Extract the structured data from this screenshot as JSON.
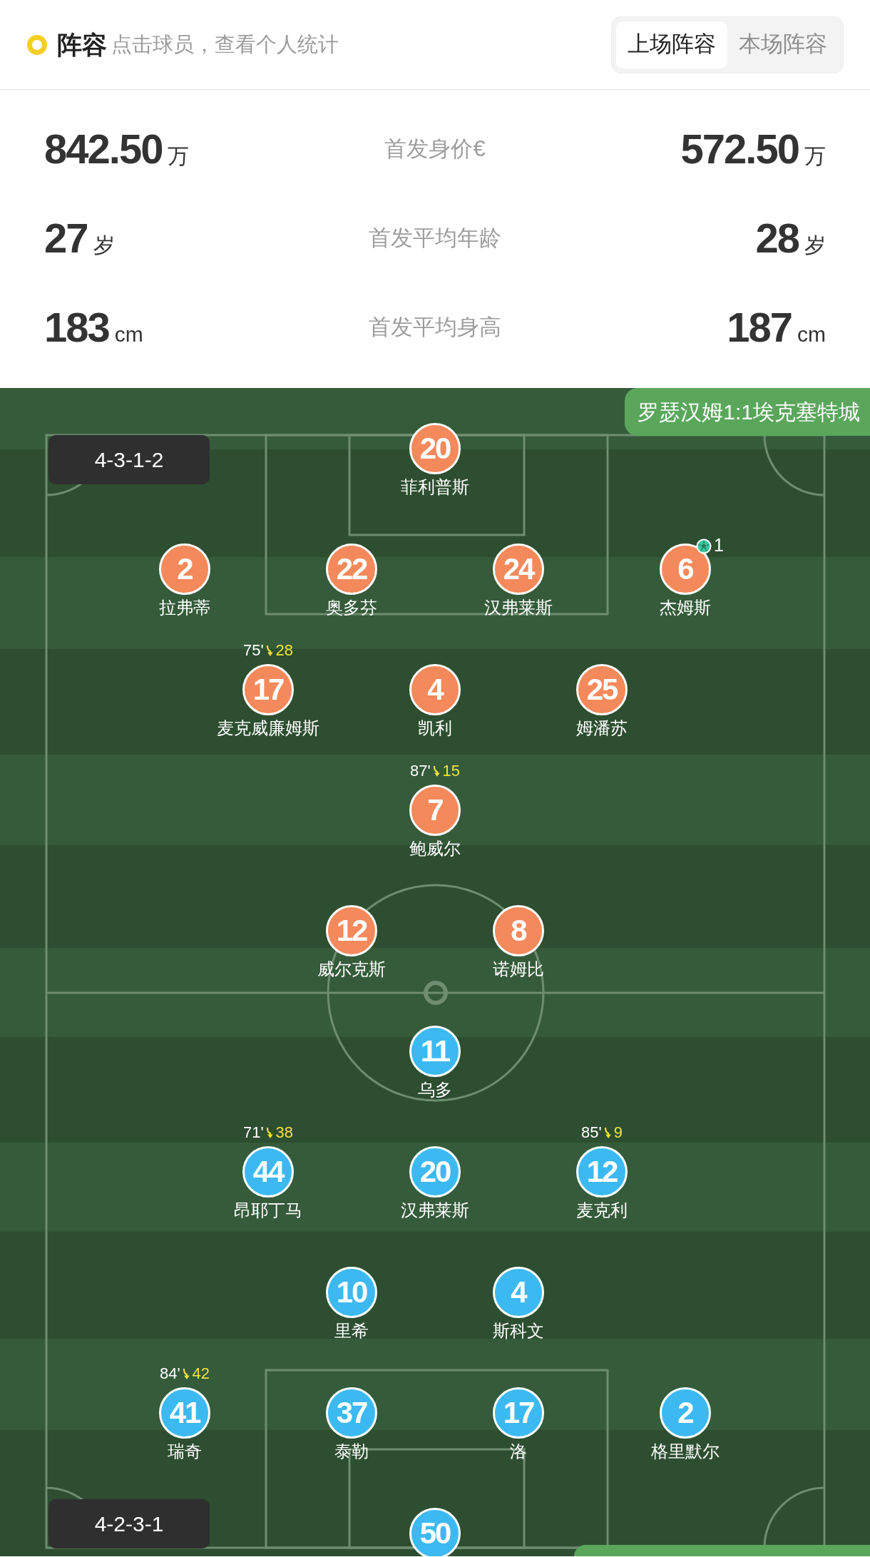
{
  "header": {
    "title": "阵容",
    "hint": "点击球员，查看个人统计",
    "tabs": [
      {
        "label": "上场阵容",
        "selected": true
      },
      {
        "label": "本场阵容",
        "selected": false
      }
    ]
  },
  "stats": [
    {
      "home_value": "842.50",
      "home_unit": "万",
      "label": "首发身价€",
      "away_value": "572.50",
      "away_unit": "万"
    },
    {
      "home_value": "27",
      "home_unit": "岁",
      "label": "首发平均年龄",
      "away_value": "28",
      "away_unit": "岁"
    },
    {
      "home_value": "183",
      "home_unit": "cm",
      "label": "首发平均身高",
      "away_value": "187",
      "away_unit": "cm"
    }
  ],
  "pitch": {
    "score": "罗瑟汉姆1:1埃克塞特城",
    "teams": [
      {
        "formation": "4-3-1-2",
        "color": "#f4895b",
        "lines": [
          {
            "players": [
              {
                "number": "20",
                "name": "菲利普斯"
              }
            ]
          },
          {
            "players": [
              {
                "number": "2",
                "name": "拉弗蒂"
              },
              {
                "number": "22",
                "name": "奥多芬"
              },
              {
                "number": "24",
                "name": "汉弗莱斯"
              },
              {
                "number": "6",
                "name": "杰姆斯",
                "goals": "1"
              }
            ]
          },
          {
            "players": [
              {
                "number": "17",
                "name": "麦克威廉姆斯",
                "sub": {
                  "minute": "75'",
                  "replacement": "28"
                }
              },
              {
                "number": "4",
                "name": "凯利"
              },
              {
                "number": "25",
                "name": "姆潘苏"
              }
            ]
          },
          {
            "players": [
              {
                "number": "7",
                "name": "鲍威尔",
                "sub": {
                  "minute": "87'",
                  "replacement": "15"
                }
              }
            ]
          },
          {
            "players": [
              {
                "number": "12",
                "name": "威尔克斯"
              },
              {
                "number": "8",
                "name": "诺姆比"
              }
            ]
          }
        ]
      },
      {
        "formation": "4-2-3-1",
        "color": "#3db9f1",
        "lines": [
          {
            "players": [
              {
                "number": "11",
                "name": "乌多"
              }
            ]
          },
          {
            "players": [
              {
                "number": "44",
                "name": "昂耶丁马",
                "sub": {
                  "minute": "71'",
                  "replacement": "38"
                }
              },
              {
                "number": "20",
                "name": "汉弗莱斯"
              },
              {
                "number": "12",
                "name": "麦克利",
                "sub": {
                  "minute": "85'",
                  "replacement": "9"
                }
              }
            ]
          },
          {
            "players": [
              {
                "number": "10",
                "name": "里希"
              },
              {
                "number": "4",
                "name": "斯科文"
              }
            ]
          },
          {
            "players": [
              {
                "number": "41",
                "name": "瑞奇",
                "sub": {
                  "minute": "84'",
                  "replacement": "42"
                }
              },
              {
                "number": "37",
                "name": "泰勒"
              },
              {
                "number": "17",
                "name": "洛"
              },
              {
                "number": "2",
                "name": "格里默尔"
              }
            ]
          },
          {
            "players": [
              {
                "number": "50"
              }
            ]
          }
        ]
      }
    ]
  }
}
